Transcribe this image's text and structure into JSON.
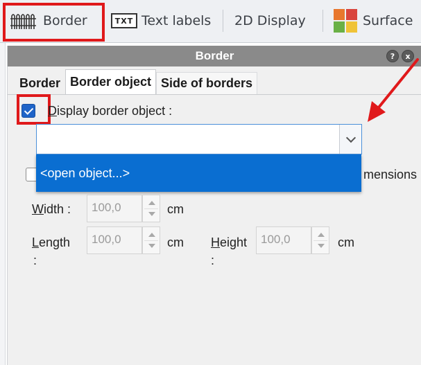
{
  "toolbar": {
    "items": [
      {
        "label": "Border",
        "icon": "border-fence-icon"
      },
      {
        "label": "Text labels",
        "icon": "txt-icon",
        "icon_text": "TXT"
      },
      {
        "label": "2D Display"
      },
      {
        "label": "Surface",
        "icon": "surface-grid-icon"
      }
    ]
  },
  "panel": {
    "title": "Border",
    "help_glyph": "?",
    "close_glyph": "x",
    "tabs": [
      {
        "label": "Border",
        "active": false
      },
      {
        "label": "Border object",
        "active": true
      },
      {
        "label": "Side of borders",
        "active": false
      }
    ],
    "display_border_object": {
      "label": "Display border object :",
      "checked": true
    },
    "object_combo": {
      "value": ""
    },
    "dropdown": {
      "options": [
        "<open object...>"
      ],
      "highlighted": 0
    },
    "dimensions_label_partial": "mensions",
    "width": {
      "label": "Width :",
      "value": "100,0",
      "unit": "cm"
    },
    "length": {
      "label_line1": "Length",
      "label_line2": ":",
      "value": "100,0",
      "unit": "cm"
    },
    "height": {
      "label_line1": "Height",
      "label_line2": ":",
      "value": "100,0",
      "unit": "cm"
    }
  },
  "annotations": {
    "highlight_color": "#e0191b"
  },
  "colors": {
    "accent": "#0a6ed1",
    "checkbox": "#1f64c8",
    "header": "#8a8a8a"
  }
}
